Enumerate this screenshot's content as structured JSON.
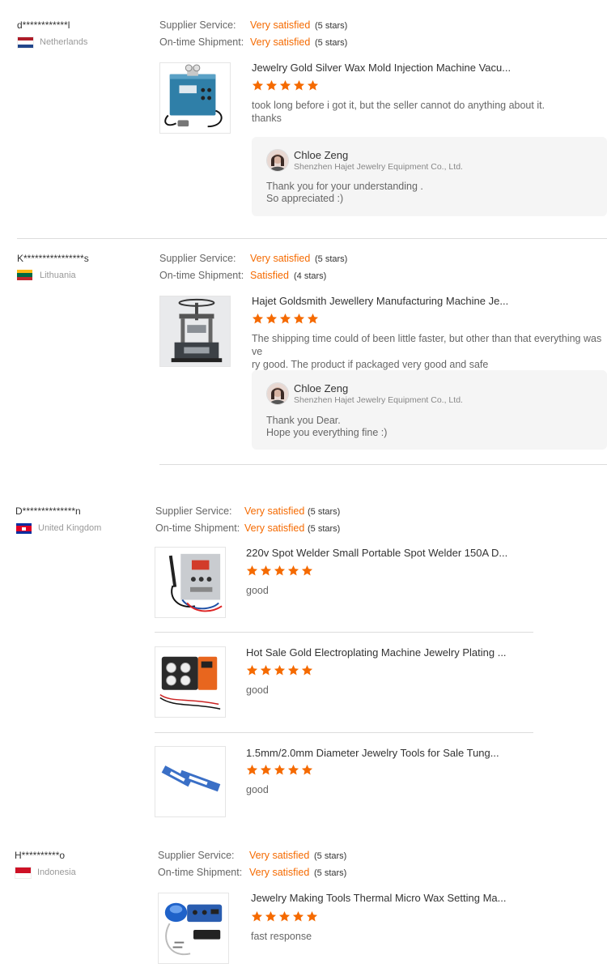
{
  "reviews": [
    {
      "user": "d************l",
      "country": "Netherlands",
      "supplier_label": "Supplier Service:",
      "supplier_rating": "Very satisfied",
      "supplier_stars": "(5 stars)",
      "shipment_label": "On-time Shipment:",
      "shipment_rating": "Very satisfied",
      "shipment_stars": "(5 stars)",
      "products": [
        {
          "title": "Jewelry Gold Silver Wax Mold Injection Machine Vacu...",
          "rating": 5,
          "comment_1": "took long before i got it, but the seller cannot do anything about it.",
          "comment_2": "thanks"
        }
      ],
      "reply": {
        "name": "Chloe Zeng",
        "company": "Shenzhen Hajet Jewelry Equipment Co., Ltd.",
        "line_1": "Thank you for your understanding .",
        "line_2": "So appreciated :)"
      }
    },
    {
      "user": "K****************s",
      "country": "Lithuania",
      "supplier_label": "Supplier Service:",
      "supplier_rating": "Very satisfied",
      "supplier_stars": "(5 stars)",
      "shipment_label": "On-time Shipment:",
      "shipment_rating": "Satisfied",
      "shipment_stars": "(4 stars)",
      "products": [
        {
          "title": "Hajet Goldsmith Jewellery Manufacturing Machine Je...",
          "rating": 5,
          "comment_1": "The shipping time could of been little faster, but other than that everything was ve",
          "comment_2": "ry good. The product if packaged very good and safe"
        }
      ],
      "reply": {
        "name": "Chloe Zeng",
        "company": "Shenzhen Hajet Jewelry Equipment Co., Ltd.",
        "line_1": "Thank you Dear.",
        "line_2": "Hope you everything fine :)"
      }
    },
    {
      "user": "D**************n",
      "country": "United Kingdom",
      "supplier_label": "Supplier Service:",
      "supplier_rating": "Very satisfied",
      "supplier_stars": "(5 stars)",
      "shipment_label": "On-time Shipment:",
      "shipment_rating": "Very satisfied",
      "shipment_stars": "(5 stars)",
      "products": [
        {
          "title": "220v Spot Welder Small Portable Spot Welder 150A D...",
          "rating": 5,
          "comment_1": "good"
        },
        {
          "title": "Hot Sale Gold Electroplating Machine Jewelry Plating ...",
          "rating": 5,
          "comment_1": "good"
        },
        {
          "title": "1.5mm/2.0mm Diameter Jewelry Tools for Sale Tung...",
          "rating": 5,
          "comment_1": "good"
        }
      ]
    },
    {
      "user": "H**********o",
      "country": "Indonesia",
      "supplier_label": "Supplier Service:",
      "supplier_rating": "Very satisfied",
      "supplier_stars": "(5 stars)",
      "shipment_label": "On-time Shipment:",
      "shipment_rating": "Very satisfied",
      "shipment_stars": "(5 stars)",
      "products": [
        {
          "title": "Jewelry Making Tools Thermal Micro Wax Setting Ma...",
          "rating": 5,
          "comment_1": "fast response"
        }
      ]
    }
  ],
  "colors": {
    "accent": "#f56a00",
    "label": "#666666",
    "reply_bg": "#f5f5f5"
  },
  "icons": [
    "flag-netherlands-icon",
    "flag-lithuania-icon",
    "flag-cambodia-icon",
    "flag-indonesia-icon",
    "star-icon",
    "avatar-icon"
  ]
}
